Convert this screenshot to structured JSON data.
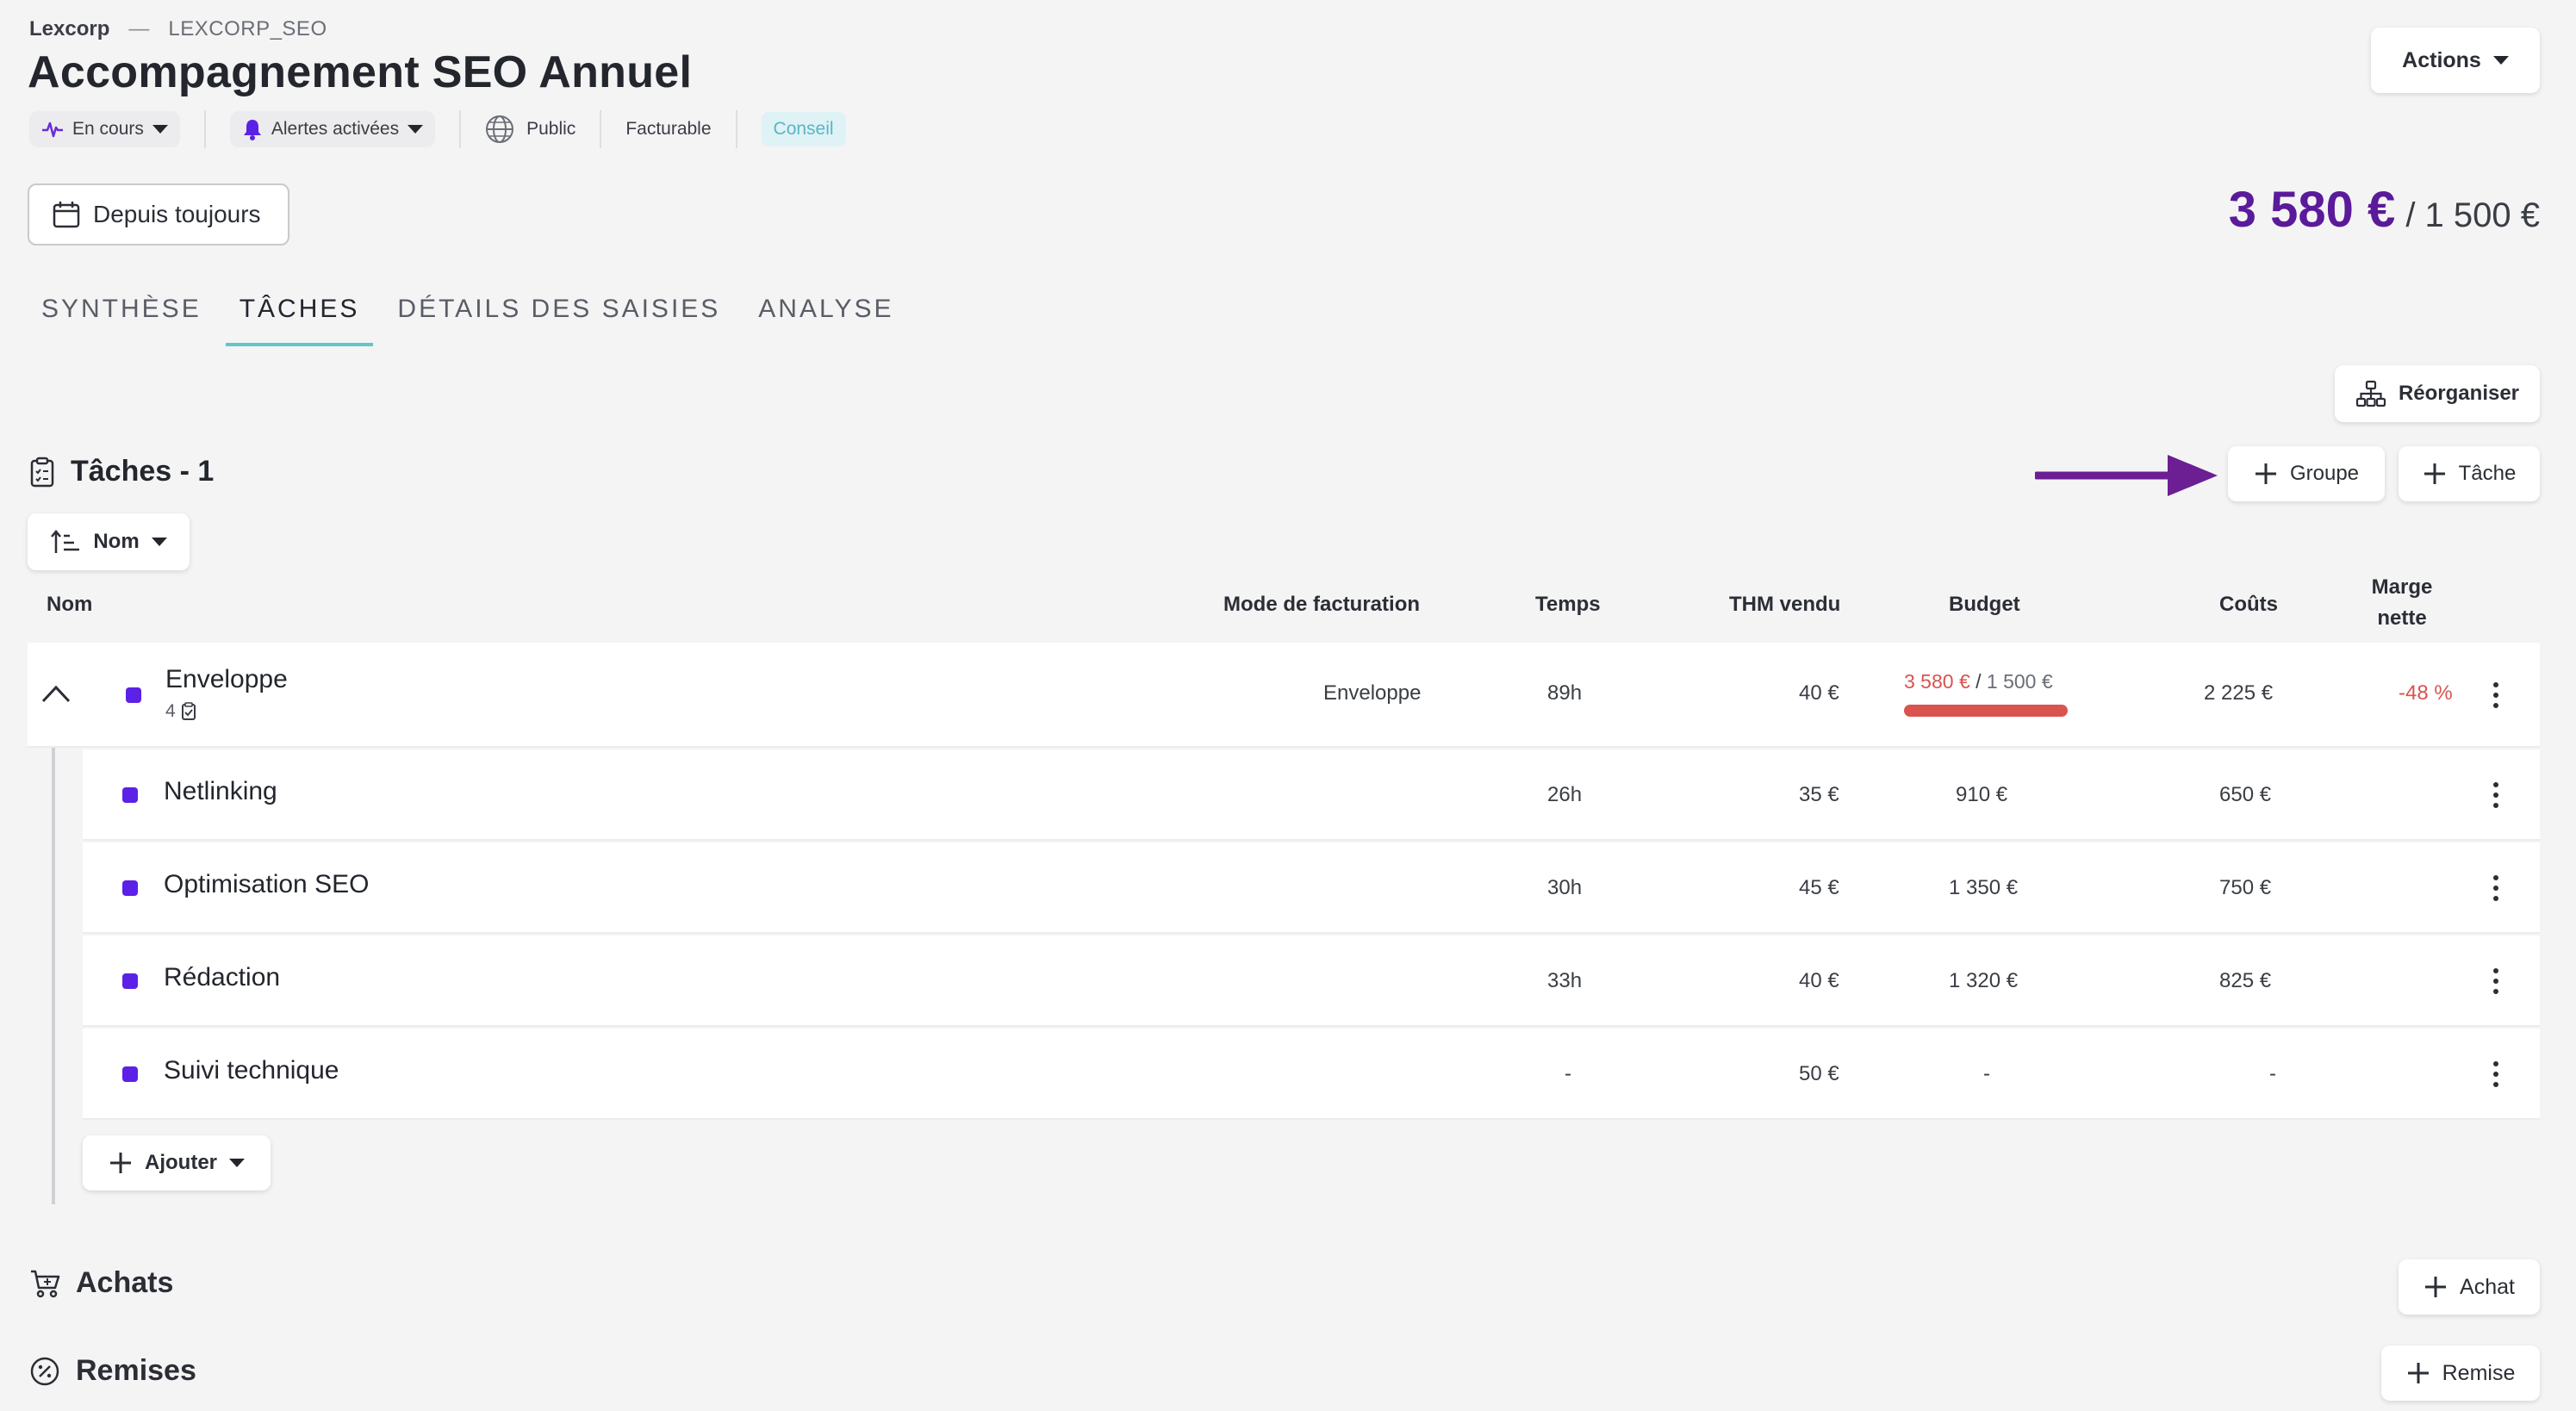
{
  "header": {
    "org": "Lexcorp",
    "separator": "—",
    "code": "LEXCORP_SEO",
    "title": "Accompagnement SEO Annuel",
    "status": "En cours",
    "alerts": "Alertes activées",
    "visibility": "Public",
    "billable": "Facturable",
    "badge": "Conseil",
    "actions_label": "Actions",
    "date_filter": "Depuis toujours",
    "total_main": "3 580 €",
    "total_sub": "/ 1 500 €"
  },
  "tabs": [
    {
      "label": "SYNTHÈSE",
      "active": false
    },
    {
      "label": "TÂCHES",
      "active": true
    },
    {
      "label": "DÉTAILS DES SAISIES",
      "active": false
    },
    {
      "label": "ANALYSE",
      "active": false
    }
  ],
  "toolbar": {
    "reorganize": "Réorganiser",
    "tasks_heading": "Tâches - 1",
    "add_group": "Groupe",
    "add_task": "Tâche",
    "sort_label": "Nom"
  },
  "table": {
    "headers": {
      "name": "Nom",
      "billing_mode": "Mode de facturation",
      "time": "Temps",
      "rate": "THM vendu",
      "budget": "Budget",
      "costs": "Coûts",
      "margin_line1": "Marge",
      "margin_line2": "nette"
    },
    "group": {
      "name": "Enveloppe",
      "task_count": "4",
      "billing_mode": "Enveloppe",
      "time": "89h",
      "rate": "40 €",
      "budget_spent": "3 580 €",
      "budget_separator": "/",
      "budget_total": "1 500 €",
      "budget_progress": 1.0,
      "costs": "2 225 €",
      "margin": "-48 %"
    },
    "tasks": [
      {
        "name": "Netlinking",
        "time": "26h",
        "rate": "35 €",
        "budget": "910 €",
        "costs": "650 €"
      },
      {
        "name": "Optimisation SEO",
        "time": "30h",
        "rate": "45 €",
        "budget": "1 350 €",
        "costs": "750 €"
      },
      {
        "name": "Rédaction",
        "time": "33h",
        "rate": "40 €",
        "budget": "1 320 €",
        "costs": "825 €"
      },
      {
        "name": "Suivi technique",
        "time": "-",
        "rate": "50 €",
        "budget": "-",
        "costs": "-"
      }
    ],
    "add_label": "Ajouter"
  },
  "sections": {
    "purchases_title": "Achats",
    "purchases_add": "Achat",
    "discounts_title": "Remises",
    "discounts_add": "Remise"
  },
  "colors": {
    "accent_purple": "#5a1a9a",
    "task_dot": "#5b21e6",
    "tab_underline": "#63c6c8",
    "negative": "#d9534f",
    "arrow": "#6b1f93"
  }
}
